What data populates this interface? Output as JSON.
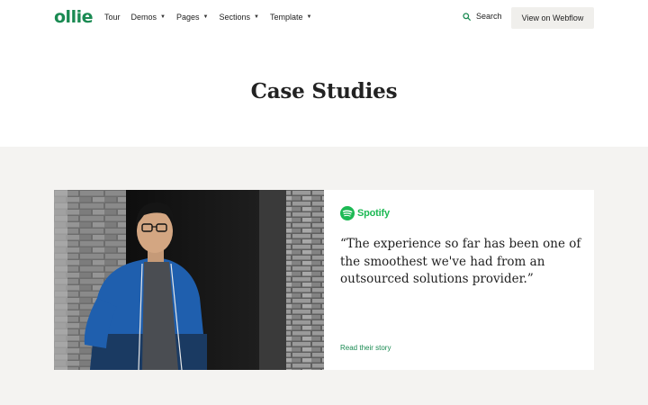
{
  "header": {
    "logo": "ollie",
    "nav": [
      {
        "label": "Tour",
        "dropdown": false
      },
      {
        "label": "Demos",
        "dropdown": true
      },
      {
        "label": "Pages",
        "dropdown": true
      },
      {
        "label": "Sections",
        "dropdown": true
      },
      {
        "label": "Template",
        "dropdown": true
      }
    ],
    "search_label": "Search",
    "cta_label": "View on Webflow"
  },
  "hero": {
    "title": "Case Studies"
  },
  "case_study": {
    "brand": "Spotify",
    "brand_icon": "spotify-logo-icon",
    "quote": "“The experience so far has been one of the smoothest we've had from an outsourced solutions provider.”",
    "link_label": "Read their story"
  },
  "colors": {
    "brand_green": "#1a8a52",
    "spotify_green": "#1db954",
    "section_bg": "#f4f3f1"
  }
}
